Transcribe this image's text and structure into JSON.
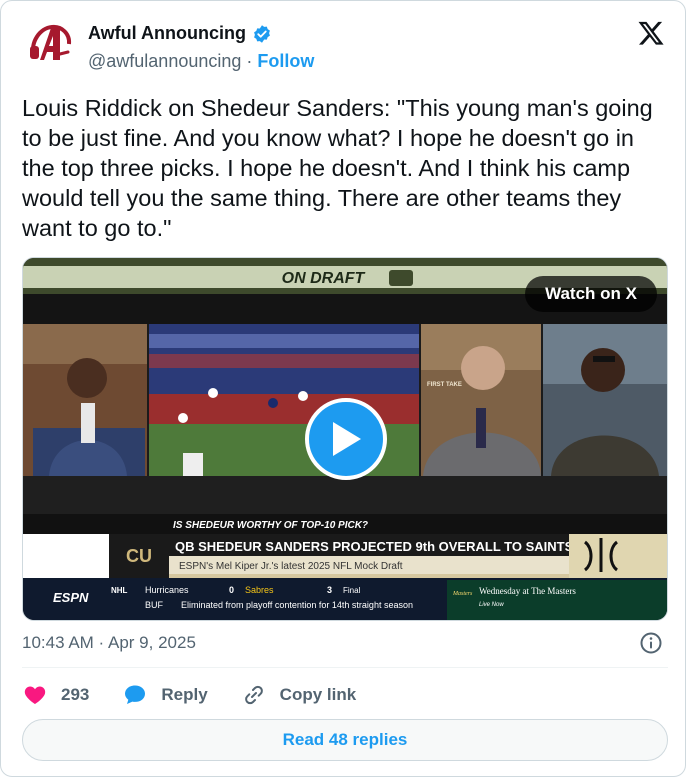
{
  "author": {
    "name": "Awful Announcing",
    "handle": "@awfulannouncing",
    "follow_label": "Follow",
    "separator": "·"
  },
  "tweet": {
    "text": "Louis Riddick on Shedeur Sanders: \"This young man's going to be just fine. And you know what? I hope he doesn't go in the top three picks. I hope he doesn't. And I think his camp would tell you the same thing. There are other teams they want to go to.\"",
    "timestamp": "10:43 AM · Apr 9, 2025"
  },
  "media": {
    "watch_label": "Watch on X",
    "banner": "ON DRAFT",
    "question": "IS SHEDEUR WORTHY OF TOP-10 PICK?",
    "headline": "QB SHEDEUR SANDERS PROJECTED 9th OVERALL TO SAINTS",
    "subheadline": "ESPN's Mel Kiper Jr.'s latest 2025 NFL Mock Draft",
    "ticker_network": "ESPN",
    "ticker_league": "NHL",
    "ticker_team1": "Hurricanes",
    "ticker_score1": "0",
    "ticker_team2": "Sabres",
    "ticker_score2": "3",
    "ticker_status": "Final",
    "ticker_team_abbr": "BUF",
    "ticker_note": "Eliminated from playoff contention for 14th straight season",
    "promo_line1": "Wednesday at The Masters",
    "promo_line2": "Live Now",
    "promo_brand": "Masters",
    "panel_label_right": "FIRST TAKE"
  },
  "actions": {
    "likes": "293",
    "reply_label": "Reply",
    "copy_label": "Copy link"
  },
  "read_replies_label": "Read 48 replies",
  "colors": {
    "accent": "#1d9bf0",
    "like": "#f91880",
    "text": "#0f1419",
    "secondary": "#536471",
    "brand_red": "#a6192e"
  }
}
